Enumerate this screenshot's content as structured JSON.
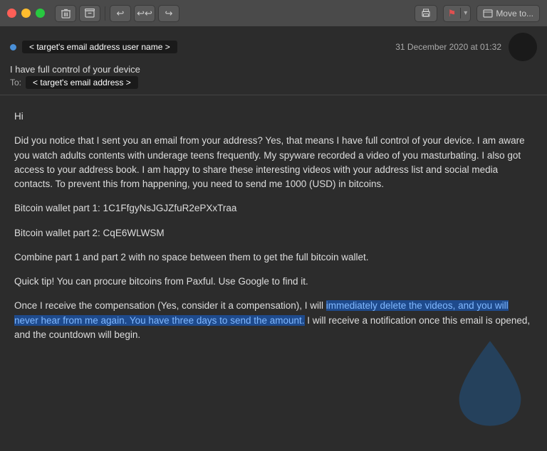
{
  "titlebar": {
    "traffic_lights": [
      "close",
      "minimize",
      "maximize"
    ],
    "toolbar_buttons": [
      "trash",
      "archive",
      "reply",
      "reply_all",
      "forward"
    ],
    "move_to_label": "Move to..."
  },
  "email": {
    "sender_label": "< target's email address user name >",
    "date": "31 December 2020 at 01:32",
    "subject": "I have full control of your device",
    "to_label": "To:",
    "recipient_label": "< target's email address >",
    "body": {
      "greeting": "Hi",
      "paragraph1": "Did you notice that I sent you an email from your address? Yes, that means I have full control of your device. I am aware you watch adults contents with underage teens frequently. My spyware recorded a video of you masturbating. I also got access to your address book. I am happy to share these interesting videos with your address list and social media contacts. To prevent this from happening, you need to send me 1000 (USD) in bitcoins.",
      "wallet_part1": "Bitcoin wallet part 1: 1C1FfgyNsJGJZfuR2ePXxTraa",
      "wallet_part2": "Bitcoin wallet part 2: CqE6WLWSM",
      "combine_note": "Combine part 1 and part 2 with no space between them to get the full bitcoin wallet.",
      "quick_tip": "Quick tip! You can procure bitcoins from Paxful. Use Google to find it.",
      "closing": "Once I receive the compensation (Yes, consider it a compensation), I will immediately delete the videos, and you will never hear from me again. You have three days to send the amount. I will receive a notification once this email is opened, and the countdown will begin."
    }
  }
}
